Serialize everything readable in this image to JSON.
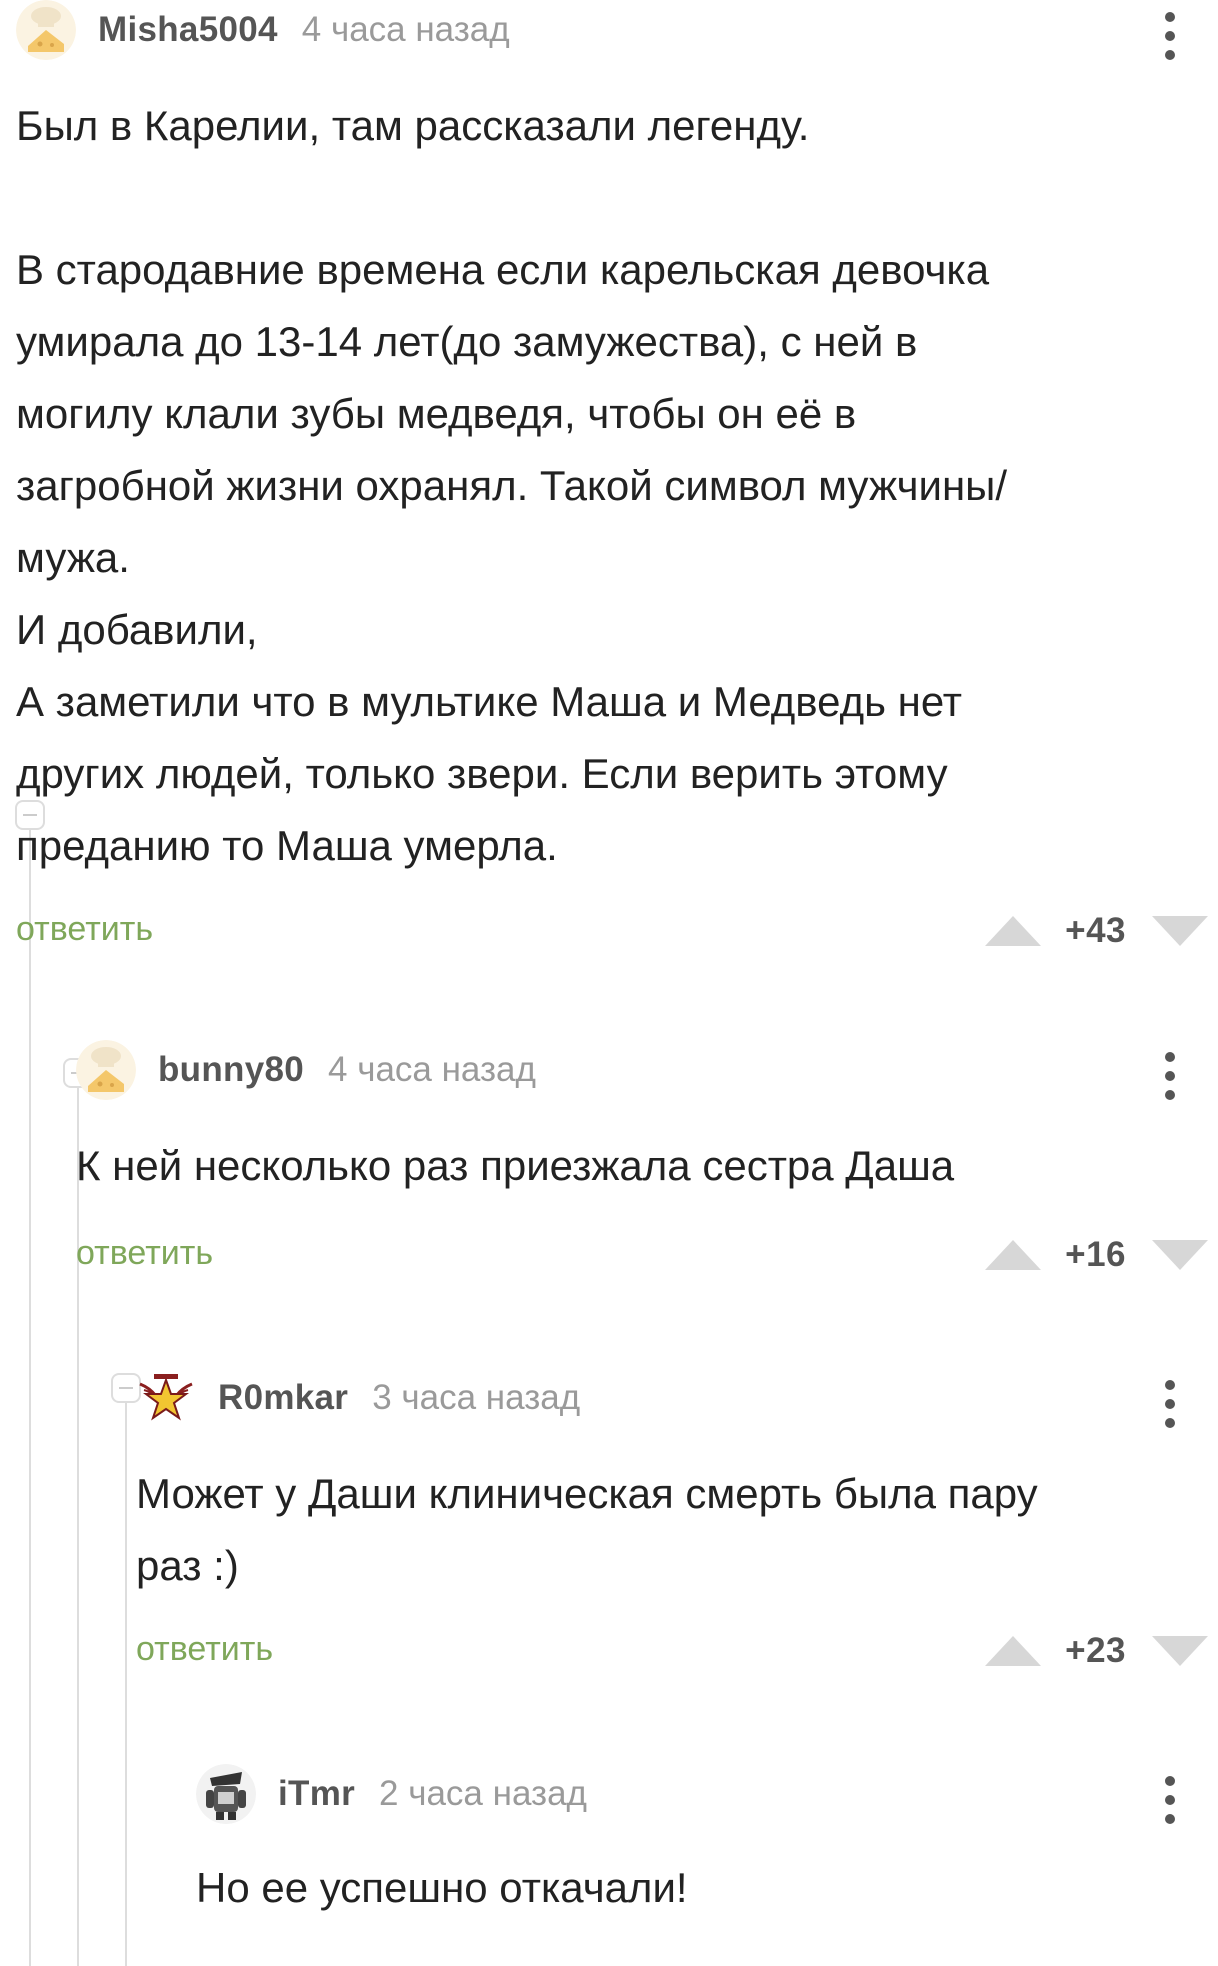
{
  "comments": [
    {
      "username": "Misha5004",
      "time": "4 часа назад",
      "avatar": "chef-cheese-avatar",
      "text": "Был в Карелии, там рассказали легенду.\n\nВ стародавние времена если карельская девочка\nумирала до 13-14 лет(до замужества), с ней в\nмогилу клали зубы медведя, чтобы он её в\nзагробной жизни охранял. Такой символ мужчины/\nмужа.\nИ добавили,\nА заметили что в мультике Маша и Медведь нет\nдругих людей, только звери. Если верить этому\nпреданию то Маша умерла.",
      "reply_label": "ответить",
      "rating": "+43"
    },
    {
      "username": "bunny80",
      "time": "4 часа назад",
      "avatar": "chef-cheese-avatar",
      "text": "К ней несколько раз приезжала сестра Даша",
      "reply_label": "ответить",
      "rating": "+16"
    },
    {
      "username": "R0mkar",
      "time": "3 часа назад",
      "avatar": "winged-star-avatar",
      "text": "Может у Даши клиническая смерть была пару\nраз :)",
      "reply_label": "ответить",
      "rating": "+23"
    },
    {
      "username": "iTmr",
      "time": "2 часа назад",
      "avatar": "robot-figure-avatar",
      "text": "Но ее успешно откачали!"
    }
  ],
  "colors": {
    "reply_link": "#7fa75a",
    "username": "#555555",
    "timestamp": "#9a9a9a",
    "vote_arrow": "#d7d7d7",
    "branch_line": "#dddddd"
  }
}
